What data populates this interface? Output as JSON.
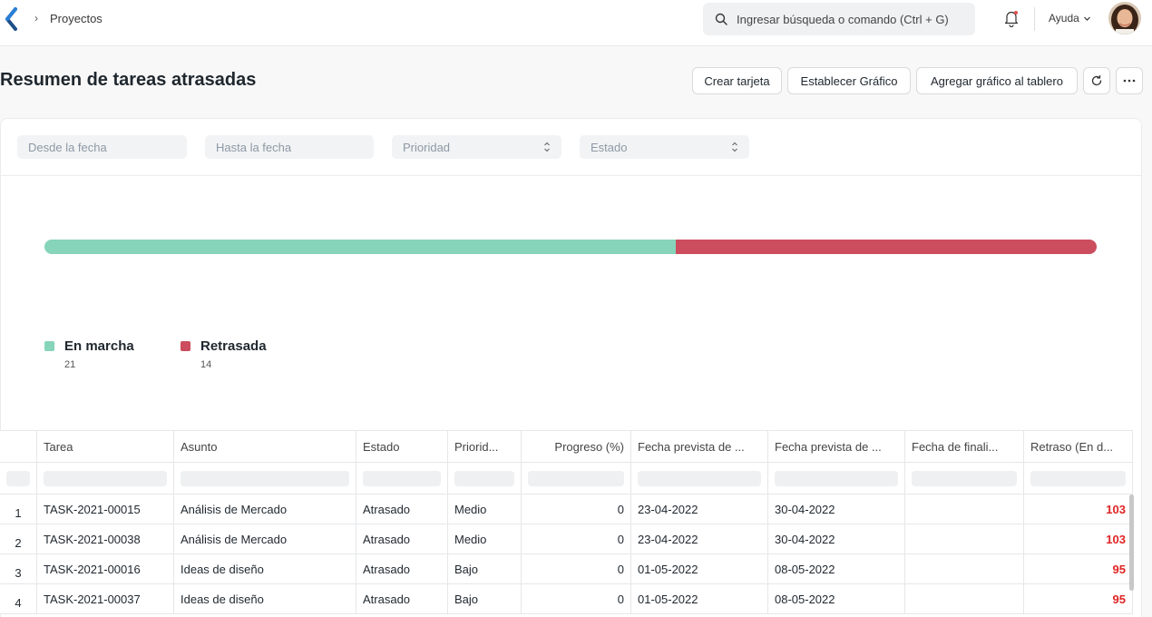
{
  "navbar": {
    "breadcrumb": "Proyectos",
    "search_placeholder": "Ingresar búsqueda o comando (Ctrl + G)",
    "help_label": "Ayuda"
  },
  "page": {
    "title": "Resumen de tareas atrasadas",
    "buttons": {
      "create_card": "Crear tarjeta",
      "set_chart": "Establecer Gráfico",
      "add_to_dashboard": "Agregar gráfico al tablero"
    }
  },
  "filters": {
    "from_date": "Desde la fecha",
    "to_date": "Hasta la fecha",
    "priority": "Prioridad",
    "status": "Estado"
  },
  "chart_data": {
    "type": "bar",
    "categories": [
      "En marcha",
      "Retrasada"
    ],
    "values": [
      21,
      14
    ],
    "colors": [
      "#86d4b9",
      "#cb4d5e"
    ]
  },
  "legend": [
    {
      "label": "En marcha",
      "value": "21",
      "color": "#86d4b9"
    },
    {
      "label": "Retrasada",
      "value": "14",
      "color": "#cb4d5e"
    }
  ],
  "table": {
    "columns": [
      "Tarea",
      "Asunto",
      "Estado",
      "Priorid...",
      "Progreso (%)",
      "Fecha prevista de ...",
      "Fecha prevista de ...",
      "Fecha de finali...",
      "Retraso (En d..."
    ],
    "rows": [
      {
        "index": "1",
        "task": "TASK-2021-00015",
        "subject": "Análisis de Mercado",
        "status": "Atrasado",
        "priority": "Medio",
        "progress": "0",
        "exp_start": "23-04-2022",
        "exp_end": "30-04-2022",
        "completed": "",
        "delay": "103"
      },
      {
        "index": "2",
        "task": "TASK-2021-00038",
        "subject": "Análisis de Mercado",
        "status": "Atrasado",
        "priority": "Medio",
        "progress": "0",
        "exp_start": "23-04-2022",
        "exp_end": "30-04-2022",
        "completed": "",
        "delay": "103"
      },
      {
        "index": "3",
        "task": "TASK-2021-00016",
        "subject": "Ideas de diseño",
        "status": "Atrasado",
        "priority": "Bajo",
        "progress": "0",
        "exp_start": "01-05-2022",
        "exp_end": "08-05-2022",
        "completed": "",
        "delay": "95"
      },
      {
        "index": "4",
        "task": "TASK-2021-00037",
        "subject": "Ideas de diseño",
        "status": "Atrasado",
        "priority": "Bajo",
        "progress": "0",
        "exp_start": "01-05-2022",
        "exp_end": "08-05-2022",
        "completed": "",
        "delay": "95"
      }
    ]
  }
}
